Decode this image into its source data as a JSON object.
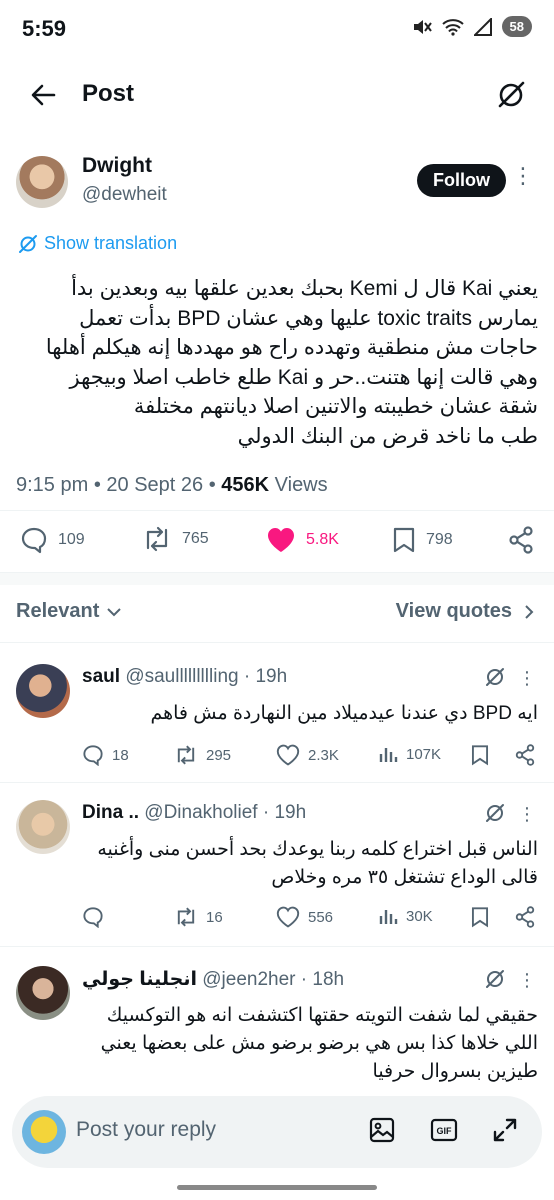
{
  "status_bar": {
    "time": "5:59",
    "battery": "58"
  },
  "header": {
    "title": "Post"
  },
  "post": {
    "author_name": "Dwight",
    "author_handle": "@dewheit",
    "follow_label": "Follow",
    "show_translation": "Show translation",
    "text": "يعني Kai قال ل Kemi بحبك بعدين علقها بيه وبعدين بدأ\nيمارس toxic traits عليها وهي عشان BPD بدأت تعمل\nحاجات مش منطقية وتهدده راح هو مهددها إنه هيكلم أهلها\nوهي قالت إنها هتنت..حر و Kai طلع خاطب اصلا وبيجهز\nشقة عشان خطيبته والاتنين اصلا ديانتهم مختلفة\nطب ما ناخد قرض من البنك الدولي",
    "time": "9:15 pm",
    "date": "20 Sept 26",
    "views_count": "456K",
    "views_label": "Views",
    "replies": "109",
    "reposts": "765",
    "likes": "5.8K",
    "bookmarks": "798"
  },
  "sort": {
    "relevant_label": "Relevant",
    "view_quotes_label": "View quotes"
  },
  "replies": [
    {
      "name": "saul",
      "handle": "@saullllllllling",
      "time": "19h",
      "text": "ايه BPD دي عندنا عيدميلاد مين النهاردة مش فاهم",
      "replies": "18",
      "reposts": "295",
      "likes": "2.3K",
      "views": "107K"
    },
    {
      "name": "Dina ..",
      "handle": "@Dinakholief",
      "time": "19h",
      "text": "الناس قبل اختراع كلمه ربنا يوعدك بحد أحسن منى وأغنيه\nقالى الوداع تشتغل ٣٥ مره وخلاص",
      "replies": "",
      "reposts": "16",
      "likes": "556",
      "views": "30K"
    },
    {
      "name": "انجلينا جولي",
      "handle": "@jeen2her",
      "time": "18h",
      "text": "حقيقي لما شفت التويته حقتها اكتشفت انه هو التوكسيك\nاللي خلاها كذا بس هي برضو برضو مش على بعضها يعني\nطيزين بسروال حرفيا"
    }
  ],
  "composer": {
    "placeholder": "Post your reply"
  },
  "colors": {
    "accent": "#1d9bf0",
    "like": "#f91880",
    "text": "#0f1419",
    "muted": "#536471"
  }
}
